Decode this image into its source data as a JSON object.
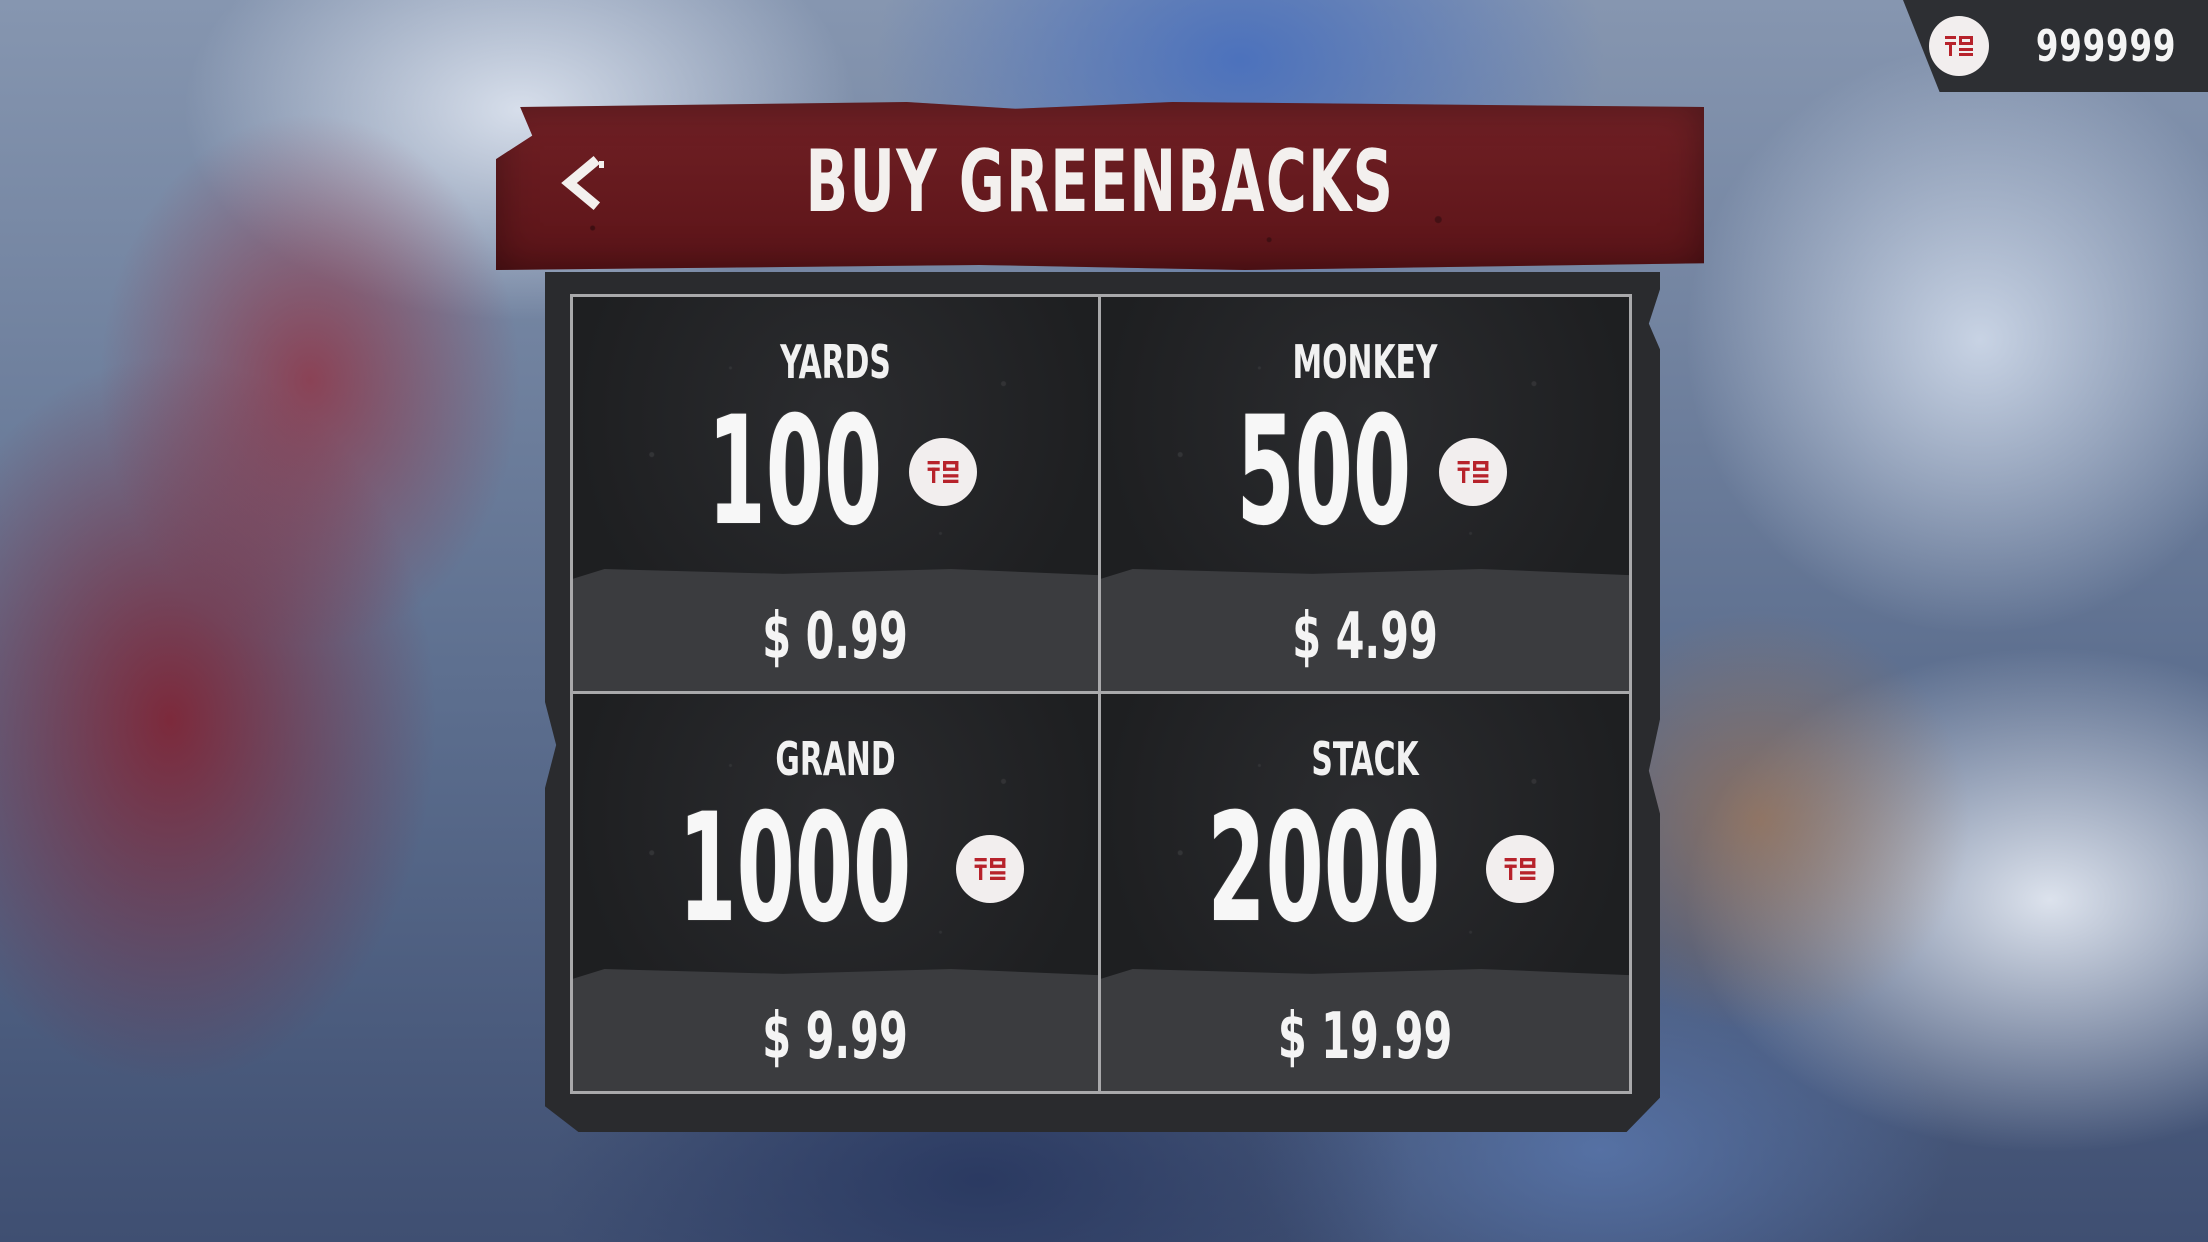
{
  "header": {
    "title": "BUY GREENBACKS",
    "back_icon": "chevron-left-icon"
  },
  "wallet": {
    "amount": "999999",
    "icon": "greenbacks-coin-icon"
  },
  "colors": {
    "banner": "#6b171c",
    "panel": "#2a2b2e",
    "coin_red": "#b7222b",
    "coin_bg": "#f2eeee"
  },
  "packs": [
    {
      "name": "YARDS",
      "amount": "100",
      "price": "$ 0.99"
    },
    {
      "name": "MONKEY",
      "amount": "500",
      "price": "$ 4.99"
    },
    {
      "name": "GRAND",
      "amount": "1000",
      "price": "$ 9.99"
    },
    {
      "name": "STACK",
      "amount": "2000",
      "price": "$ 19.99"
    }
  ]
}
